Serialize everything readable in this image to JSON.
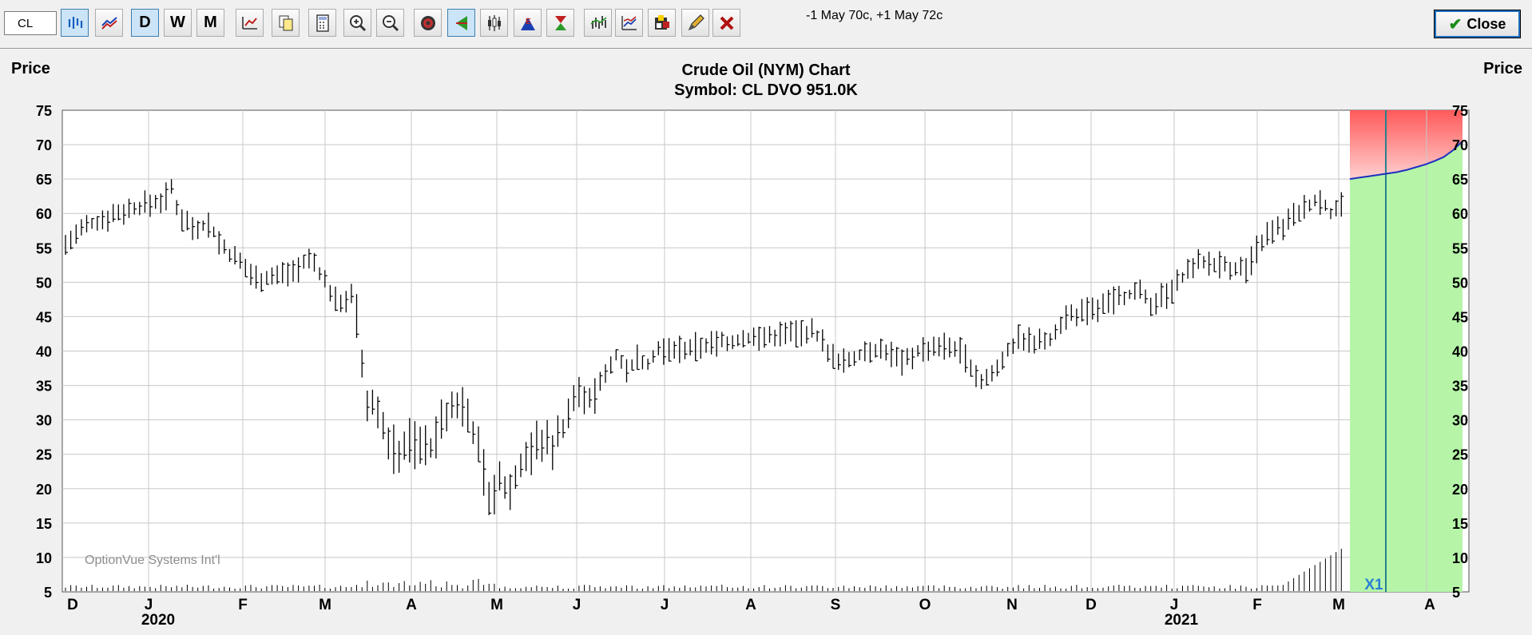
{
  "toolbar": {
    "symbol_value": "CL",
    "status_text": "-1 May 70c, +1 May 72c",
    "close_label": "Close",
    "buttons": [
      {
        "name": "bar-chart-icon",
        "letter": "",
        "active": true
      },
      {
        "name": "line-chart-icon",
        "letter": "",
        "active": false
      },
      {
        "name": "daily-button",
        "letter": "D",
        "active": true
      },
      {
        "name": "weekly-button",
        "letter": "W",
        "active": false
      },
      {
        "name": "monthly-button",
        "letter": "M",
        "active": false
      },
      {
        "name": "chart-settings-icon",
        "letter": "",
        "active": false
      },
      {
        "name": "copy-chart-icon",
        "letter": "",
        "active": false
      },
      {
        "name": "calculator-icon",
        "letter": "",
        "active": false
      },
      {
        "name": "zoom-in-icon",
        "letter": "",
        "active": false
      },
      {
        "name": "zoom-out-icon",
        "letter": "",
        "active": false
      },
      {
        "name": "target-icon",
        "letter": "",
        "active": false
      },
      {
        "name": "volatility-cone-icon",
        "letter": "",
        "active": true
      },
      {
        "name": "candlestick-icon",
        "letter": "",
        "active": false
      },
      {
        "name": "event-marker-icon",
        "letter": "",
        "active": false
      },
      {
        "name": "hourglass-icon",
        "letter": "",
        "active": false
      },
      {
        "name": "indicator-icon",
        "letter": "",
        "active": false
      },
      {
        "name": "study-icon",
        "letter": "",
        "active": false
      },
      {
        "name": "color-palette-icon",
        "letter": "",
        "active": false
      },
      {
        "name": "draw-pencil-icon",
        "letter": "",
        "active": false
      },
      {
        "name": "delete-x-icon",
        "letter": "",
        "active": false
      }
    ]
  },
  "chart_data": {
    "type": "bar",
    "title": "Crude Oil (NYM) Chart",
    "subtitle": "Symbol: CL  DVO 951.0K",
    "ylabel_left": "Price",
    "ylabel_right": "Price",
    "ylim": [
      5,
      75
    ],
    "y_ticks": [
      75,
      70,
      65,
      60,
      55,
      50,
      45,
      40,
      35,
      30,
      25,
      20,
      15,
      10,
      5
    ],
    "x_month_labels": [
      "D",
      "J",
      "F",
      "M",
      "A",
      "M",
      "J",
      "J",
      "A",
      "S",
      "O",
      "N",
      "D",
      "J",
      "F",
      "M",
      "A"
    ],
    "x_year_labels": [
      "2020",
      "2021"
    ],
    "grid": true,
    "watermark": "OptionVue Systems Int'l",
    "projection_label": "X1",
    "price_path": [
      {
        "d": 0,
        "p": 55.5
      },
      {
        "d": 8,
        "p": 58
      },
      {
        "d": 20,
        "p": 60
      },
      {
        "d": 30,
        "p": 61
      },
      {
        "d": 40,
        "p": 62
      },
      {
        "d": 43,
        "p": 63.5
      },
      {
        "d": 46,
        "p": 60
      },
      {
        "d": 52,
        "p": 58
      },
      {
        "d": 58,
        "p": 58.5
      },
      {
        "d": 64,
        "p": 55
      },
      {
        "d": 70,
        "p": 53
      },
      {
        "d": 78,
        "p": 50.5
      },
      {
        "d": 86,
        "p": 51
      },
      {
        "d": 94,
        "p": 52
      },
      {
        "d": 100,
        "p": 53.5
      },
      {
        "d": 104,
        "p": 51
      },
      {
        "d": 110,
        "p": 47
      },
      {
        "d": 116,
        "p": 48
      },
      {
        "d": 120,
        "p": 42
      },
      {
        "d": 121,
        "p": 33
      },
      {
        "d": 126,
        "p": 33
      },
      {
        "d": 130,
        "p": 28
      },
      {
        "d": 134,
        "p": 25
      },
      {
        "d": 140,
        "p": 27
      },
      {
        "d": 146,
        "p": 26
      },
      {
        "d": 150,
        "p": 26
      },
      {
        "d": 152,
        "p": 29
      },
      {
        "d": 158,
        "p": 32
      },
      {
        "d": 162,
        "p": 32
      },
      {
        "d": 166,
        "p": 28
      },
      {
        "d": 170,
        "p": 22
      },
      {
        "d": 172,
        "p": 19
      },
      {
        "d": 176,
        "p": 21
      },
      {
        "d": 180,
        "p": 19
      },
      {
        "d": 186,
        "p": 24
      },
      {
        "d": 192,
        "p": 27
      },
      {
        "d": 198,
        "p": 26
      },
      {
        "d": 202,
        "p": 29
      },
      {
        "d": 206,
        "p": 33
      },
      {
        "d": 210,
        "p": 34
      },
      {
        "d": 214,
        "p": 33
      },
      {
        "d": 220,
        "p": 37
      },
      {
        "d": 224,
        "p": 39.5
      },
      {
        "d": 228,
        "p": 37
      },
      {
        "d": 232,
        "p": 39
      },
      {
        "d": 236,
        "p": 38
      },
      {
        "d": 240,
        "p": 40
      },
      {
        "d": 252,
        "p": 40.5
      },
      {
        "d": 262,
        "p": 41
      },
      {
        "d": 272,
        "p": 41.5
      },
      {
        "d": 282,
        "p": 42
      },
      {
        "d": 292,
        "p": 42.5
      },
      {
        "d": 302,
        "p": 43
      },
      {
        "d": 306,
        "p": 42
      },
      {
        "d": 310,
        "p": 40
      },
      {
        "d": 314,
        "p": 38
      },
      {
        "d": 320,
        "p": 39
      },
      {
        "d": 326,
        "p": 40.5
      },
      {
        "d": 334,
        "p": 40
      },
      {
        "d": 340,
        "p": 38
      },
      {
        "d": 346,
        "p": 40
      },
      {
        "d": 354,
        "p": 41
      },
      {
        "d": 362,
        "p": 40.5
      },
      {
        "d": 368,
        "p": 38
      },
      {
        "d": 372,
        "p": 35.5
      },
      {
        "d": 378,
        "p": 37
      },
      {
        "d": 382,
        "p": 40
      },
      {
        "d": 388,
        "p": 42
      },
      {
        "d": 394,
        "p": 41
      },
      {
        "d": 400,
        "p": 42
      },
      {
        "d": 406,
        "p": 45
      },
      {
        "d": 412,
        "p": 45.5
      },
      {
        "d": 418,
        "p": 46
      },
      {
        "d": 424,
        "p": 47
      },
      {
        "d": 430,
        "p": 48
      },
      {
        "d": 436,
        "p": 48.5
      },
      {
        "d": 440,
        "p": 47
      },
      {
        "d": 446,
        "p": 48
      },
      {
        "d": 450,
        "p": 49
      },
      {
        "d": 454,
        "p": 51
      },
      {
        "d": 458,
        "p": 52.5
      },
      {
        "d": 464,
        "p": 53
      },
      {
        "d": 470,
        "p": 52.5
      },
      {
        "d": 476,
        "p": 52
      },
      {
        "d": 480,
        "p": 52
      },
      {
        "d": 484,
        "p": 55
      },
      {
        "d": 488,
        "p": 57
      },
      {
        "d": 494,
        "p": 58
      },
      {
        "d": 500,
        "p": 60
      },
      {
        "d": 506,
        "p": 61.5
      },
      {
        "d": 510,
        "p": 62
      },
      {
        "d": 514,
        "p": 60
      },
      {
        "d": 518,
        "p": 61
      },
      {
        "d": 520,
        "p": 64.5
      }
    ],
    "total_days": 520,
    "projection": {
      "start": 65,
      "end": 70.5,
      "path": [
        65,
        65.2,
        65.4,
        65.6,
        65.8,
        66,
        66.3,
        66.7,
        67.1,
        67.6,
        68.2,
        69.2,
        70.5
      ]
    }
  }
}
